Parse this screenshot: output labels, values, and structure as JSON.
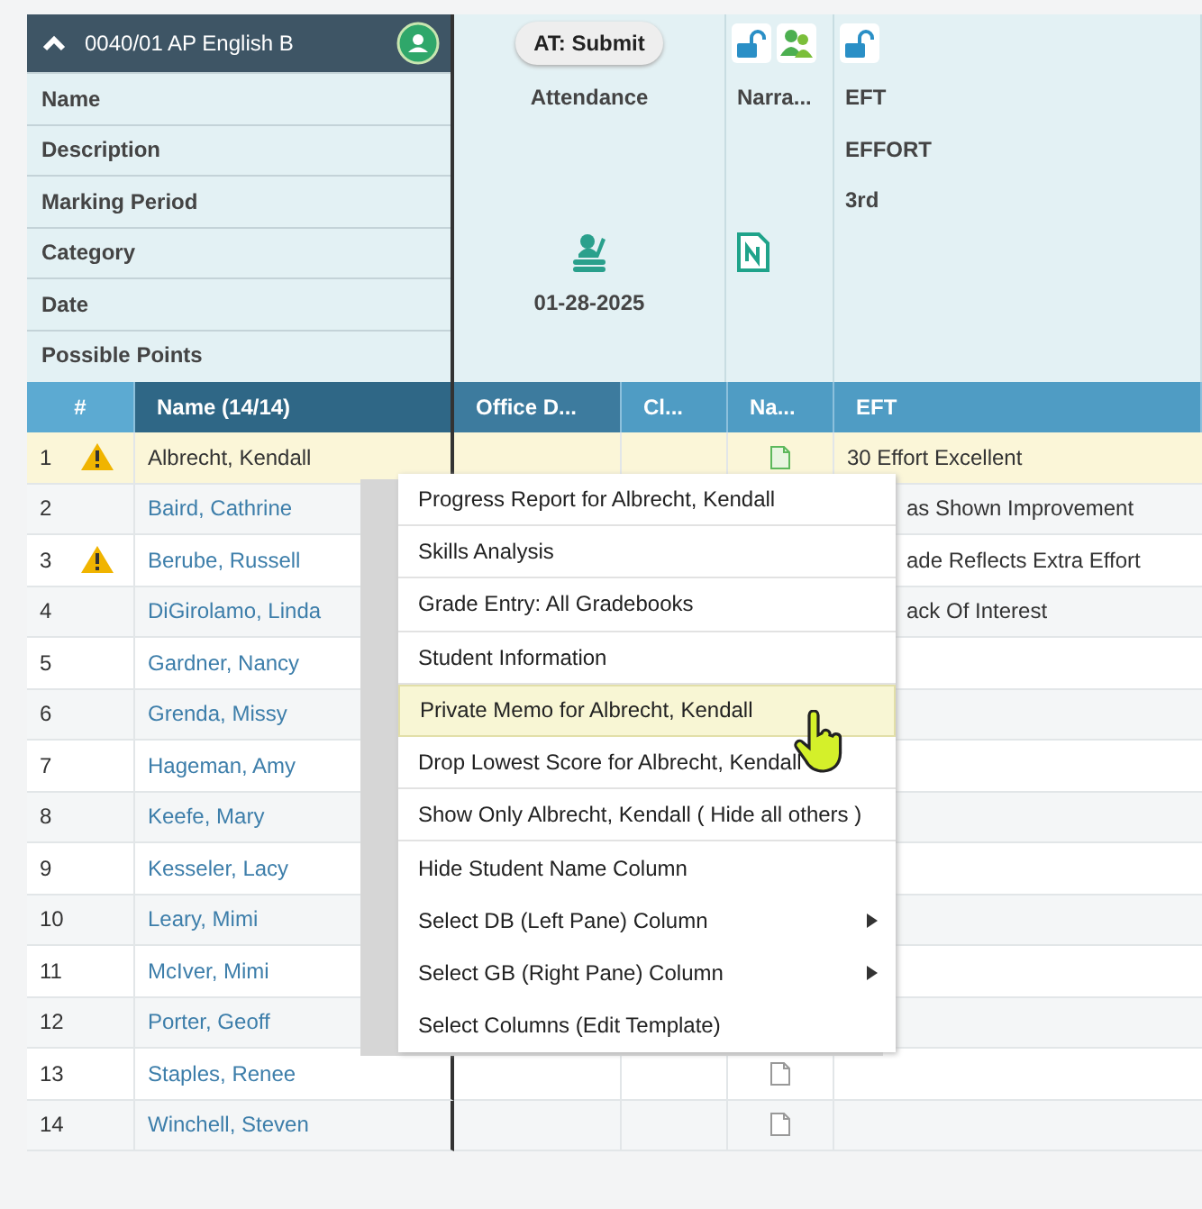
{
  "course": {
    "title": "0040/01 AP English B"
  },
  "header_labels": [
    "Name",
    "Description",
    "Marking Period",
    "Category",
    "Date",
    "Possible Points"
  ],
  "assignments": [
    {
      "kind": "attendance",
      "button": "AT: Submit",
      "name": "Attendance",
      "date": "01-28-2025"
    },
    {
      "kind": "narrative",
      "name": "Narra..."
    },
    {
      "kind": "grade",
      "name": "EFT",
      "description": "EFFORT",
      "marking_period": "3rd"
    }
  ],
  "table": {
    "columns": [
      "#",
      "Name (14/14)",
      "Office D...",
      "Cl...",
      "Na...",
      "EFT"
    ],
    "rows": [
      {
        "number": "1",
        "warning": true,
        "name": "Albrecht, Kendall",
        "selected": true,
        "note": true,
        "note_new": true,
        "eft": "30 Effort Excellent",
        "eft_covered": false
      },
      {
        "number": "2",
        "warning": false,
        "name": "Baird, Cathrine",
        "selected": false,
        "eft": "as Shown Improvement",
        "eft_covered": true
      },
      {
        "number": "3",
        "warning": true,
        "name": "Berube, Russell",
        "selected": false,
        "eft": "ade Reflects Extra Effort",
        "eft_covered": true
      },
      {
        "number": "4",
        "warning": false,
        "name": "DiGirolamo, Linda",
        "selected": false,
        "eft": "ack Of Interest",
        "eft_covered": true
      },
      {
        "number": "5",
        "warning": false,
        "name": "Gardner, Nancy",
        "selected": false
      },
      {
        "number": "6",
        "warning": false,
        "name": "Grenda, Missy",
        "selected": false
      },
      {
        "number": "7",
        "warning": false,
        "name": "Hageman, Amy",
        "selected": false
      },
      {
        "number": "8",
        "warning": false,
        "name": "Keefe, Mary",
        "selected": false
      },
      {
        "number": "9",
        "warning": false,
        "name": "Kesseler, Lacy",
        "selected": false
      },
      {
        "number": "10",
        "warning": false,
        "name": "Leary, Mimi",
        "selected": false
      },
      {
        "number": "11",
        "warning": false,
        "name": "McIver, Mimi",
        "selected": false
      },
      {
        "number": "12",
        "warning": false,
        "name": "Porter, Geoff",
        "selected": false
      },
      {
        "number": "13",
        "warning": false,
        "name": "Staples, Renee",
        "selected": false,
        "note": true,
        "note_new": false
      },
      {
        "number": "14",
        "warning": false,
        "name": "Winchell, Steven",
        "selected": false,
        "note": true,
        "note_new": false
      }
    ]
  },
  "context_menu": {
    "items": [
      {
        "label": "Progress Report for Albrecht, Kendall",
        "selected": false,
        "submenu": false
      },
      {
        "label": "Skills Analysis",
        "selected": false,
        "submenu": false
      },
      {
        "label": "Grade Entry: All Gradebooks",
        "selected": false,
        "submenu": false
      },
      {
        "label": "Student Information",
        "selected": false,
        "submenu": false
      },
      {
        "label": "Private Memo for Albrecht, Kendall",
        "selected": true,
        "submenu": false
      },
      {
        "label": "Drop Lowest Score for Albrecht, Kendall",
        "selected": false,
        "submenu": false
      },
      {
        "label": "Show Only Albrecht, Kendall ( Hide all others )",
        "selected": false,
        "submenu": false
      },
      {
        "label": "Hide Student Name Column",
        "selected": false,
        "submenu": false
      },
      {
        "label": "Select DB (Left Pane) Column",
        "selected": false,
        "submenu": true
      },
      {
        "label": "Select GB (Right Pane) Column",
        "selected": false,
        "submenu": true
      },
      {
        "label": "Select Columns (Edit Template)",
        "selected": false,
        "submenu": false
      }
    ]
  }
}
